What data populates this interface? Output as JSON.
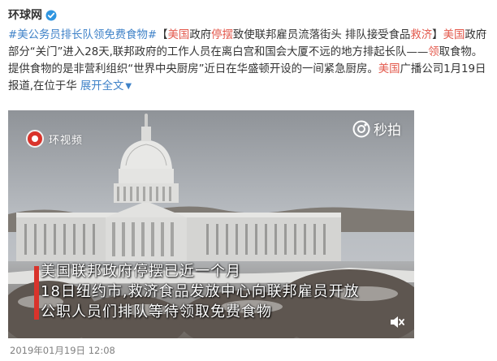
{
  "post": {
    "author": "环球网",
    "verified_icon": "verified-icon",
    "text": {
      "tag": "#美公务员排长队领免费食物#",
      "b_open": "【",
      "hl1": "美国",
      "t1": "政府",
      "hl2": "停摆",
      "t2": "致使联邦雇员流落街头 排队接受食品",
      "hl3": "救济",
      "b_close": "】",
      "hl4": "美国",
      "t3": "政府部分“关门”进入28天,联邦政府的工作人员在离白宫和国会大厦不远的地方排起长队——",
      "hl5": "领",
      "t4": "取食物。提供食物的是非营利组织“世界中央厨房”近日在华盛顿开设的一间紧急厨房。",
      "hl6": "美国",
      "t5": "广播公司1月19日报道,在位于华 ",
      "expand": "展开全文",
      "expand_icon": "chevron-down-icon"
    },
    "video": {
      "watermark_left": "环视频",
      "watermark_right": "秒拍",
      "caption_lines": [
        "美国联邦政府停摆已近一个月",
        "18日纽约市,救济食品发放中心向联邦雇员开放",
        "公职人员们排队等待领取免费食物"
      ],
      "mute_icon": "speaker-muted-icon",
      "accent_color": "#d9332b"
    },
    "timestamp": "2019年01月19日 12:08"
  },
  "colors": {
    "link": "#3f82c8",
    "highlight": "#e3584b",
    "text": "#333333",
    "meta": "#808080"
  }
}
